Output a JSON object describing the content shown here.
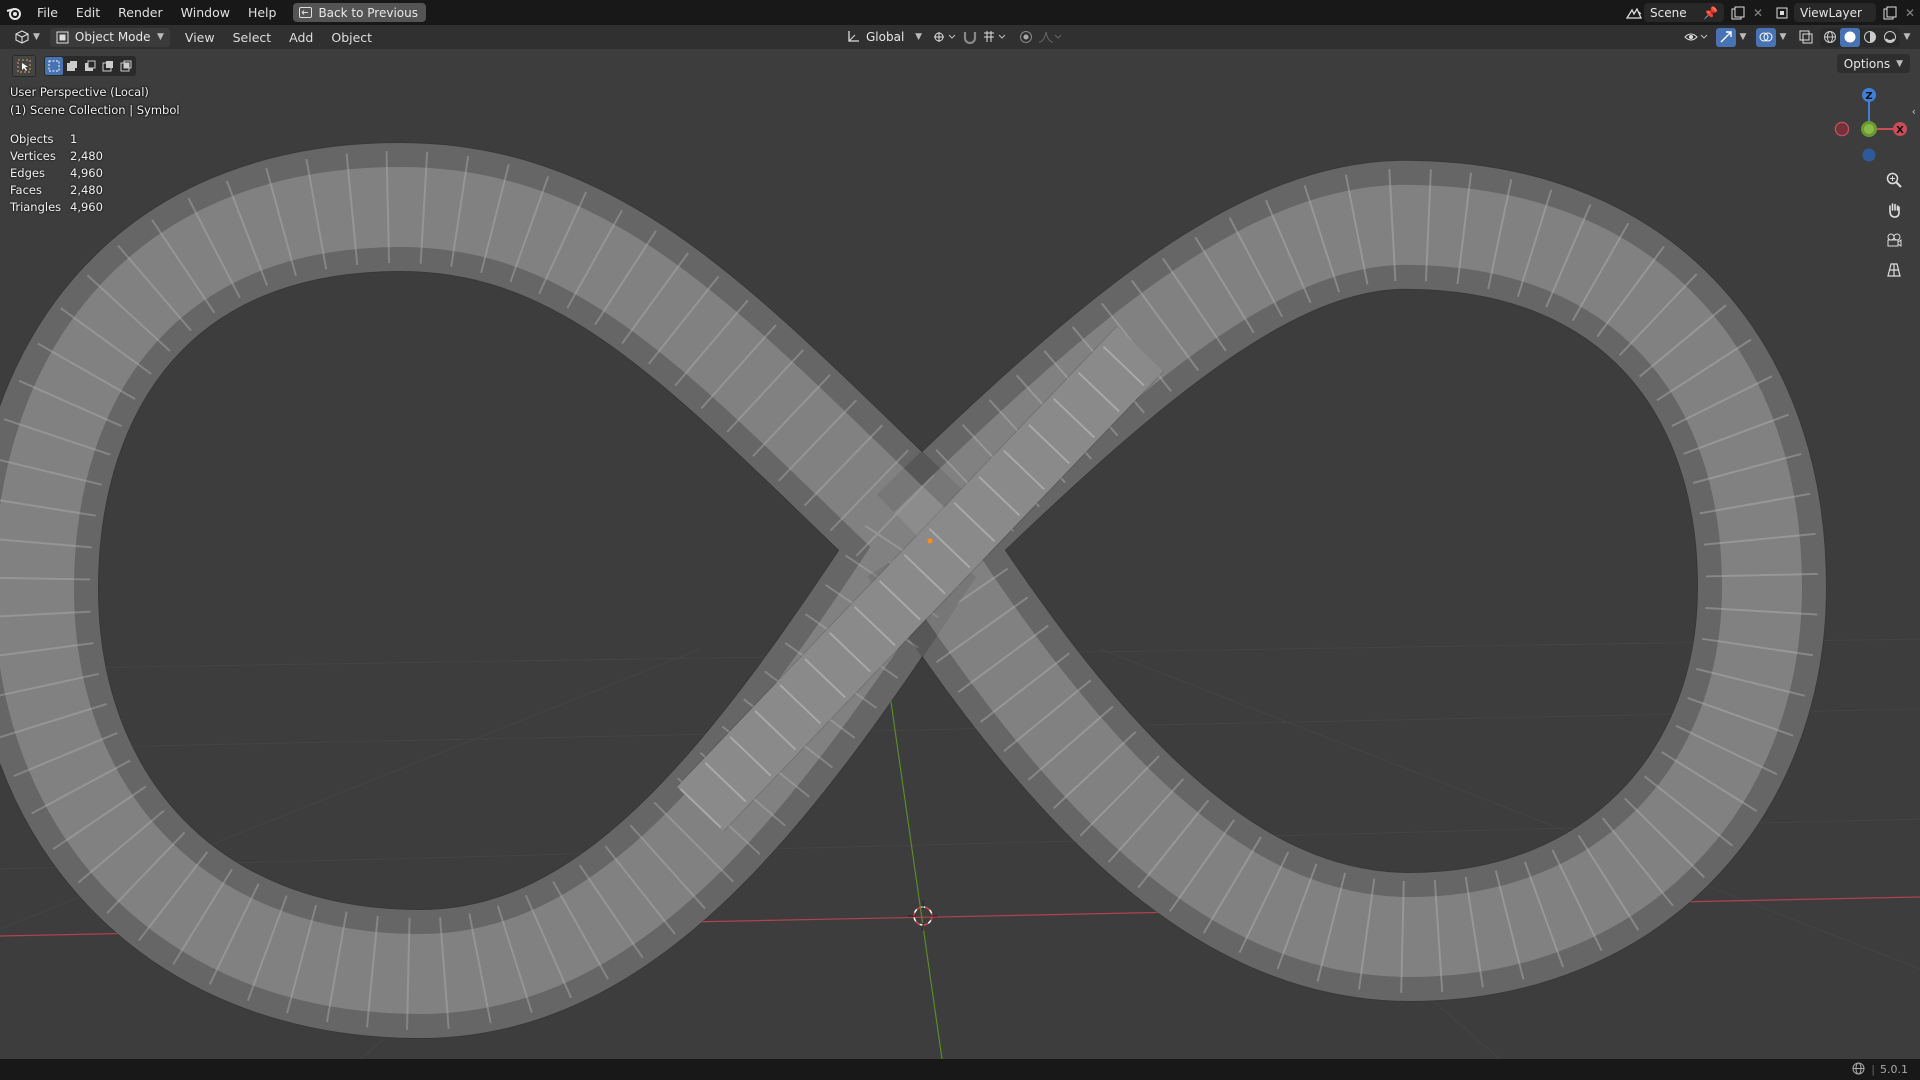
{
  "topbar": {
    "menus": [
      "File",
      "Edit",
      "Render",
      "Window",
      "Help"
    ],
    "back_label": "Back to Previous",
    "scene_name": "Scene",
    "view_layer": "ViewLayer"
  },
  "header": {
    "mode": "Object Mode",
    "menus": [
      "View",
      "Select",
      "Add",
      "Object"
    ],
    "transform_orientation": "Global"
  },
  "viewport": {
    "view_name": "User Perspective (Local)",
    "collection": "(1) Scene Collection | Symbol",
    "options_label": "Options",
    "stats": [
      {
        "label": "Objects",
        "value": "1"
      },
      {
        "label": "Vertices",
        "value": "2,480"
      },
      {
        "label": "Edges",
        "value": "4,960"
      },
      {
        "label": "Faces",
        "value": "2,480"
      },
      {
        "label": "Triangles",
        "value": "4,960"
      }
    ],
    "gizmo": {
      "x": "X",
      "y": "Y",
      "z": "Z"
    }
  },
  "statusbar": {
    "version": "5.0.1"
  },
  "colors": {
    "topbar_bg": "#181818",
    "header_bg": "#303030",
    "viewport_bg": "#3d3d3d",
    "axis_x": "#c94c57",
    "axis_y": "#6a9a2f",
    "axis_z": "#3f7fd8",
    "origin": "#ff8c1a"
  }
}
